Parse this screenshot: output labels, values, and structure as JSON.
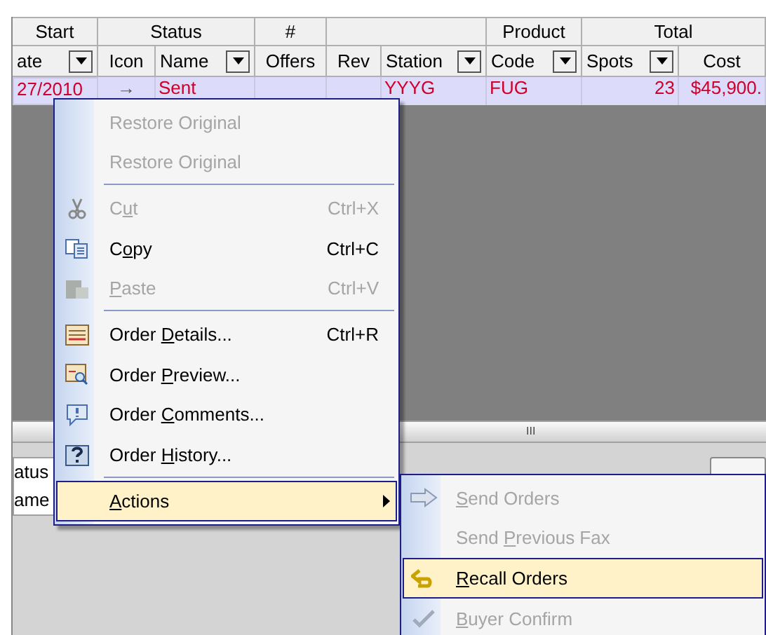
{
  "grid": {
    "groups": [
      {
        "kind": "labeled",
        "label": "Start"
      },
      {
        "kind": "labeled",
        "label": "Status"
      },
      {
        "kind": "labeled",
        "label": "#"
      },
      {
        "kind": "blank"
      },
      {
        "kind": "labeled",
        "label": "Product"
      },
      {
        "kind": "labeled",
        "label": "Total"
      }
    ],
    "columns": [
      {
        "label": "ate",
        "filter": true
      },
      {
        "label": "Icon",
        "filter": false
      },
      {
        "label": "Name",
        "filter": true
      },
      {
        "label": "Offers",
        "filter": false
      },
      {
        "label": "Rev",
        "filter": false
      },
      {
        "label": "Station",
        "filter": true
      },
      {
        "label": "Code",
        "filter": true
      },
      {
        "label": "Spots",
        "filter": true
      },
      {
        "label": "Cost",
        "filter": false
      }
    ],
    "rows": [
      {
        "selected": true,
        "cells": [
          "27/2010",
          "→",
          "Sent",
          "",
          "",
          "YYYG",
          "FUG",
          "23",
          "$45,900."
        ]
      }
    ]
  },
  "lower_pane": {
    "header": [
      "atus",
      "ame"
    ],
    "splitter_grip": "III"
  },
  "context_menu": {
    "items": [
      {
        "kind": "item",
        "label": {
          "pre": "Restore Original"
        },
        "disabled": true,
        "selected": false
      },
      {
        "kind": "item",
        "label": {
          "pre": "Restore Original"
        },
        "disabled": true,
        "selected": false
      },
      {
        "kind": "separator"
      },
      {
        "kind": "item",
        "label": {
          "pre": "C",
          "key": "u",
          "post": "t"
        },
        "shortcut": "Ctrl+X",
        "disabled": true,
        "selected": false
      },
      {
        "kind": "item",
        "label": {
          "pre": "C",
          "key": "o",
          "post": "py"
        },
        "shortcut": "Ctrl+C",
        "disabled": false,
        "selected": false
      },
      {
        "kind": "item",
        "label": {
          "key": "P",
          "post": "aste"
        },
        "shortcut": "Ctrl+V",
        "disabled": true,
        "selected": false
      },
      {
        "kind": "separator"
      },
      {
        "kind": "item",
        "label": {
          "pre": "Order ",
          "key": "D",
          "post": "etails..."
        },
        "shortcut": "Ctrl+R",
        "disabled": false,
        "selected": false
      },
      {
        "kind": "item",
        "label": {
          "pre": "Order ",
          "key": "P",
          "post": "review..."
        },
        "disabled": false,
        "selected": false
      },
      {
        "kind": "item",
        "label": {
          "pre": "Order ",
          "key": "C",
          "post": "omments..."
        },
        "disabled": false,
        "selected": false
      },
      {
        "kind": "item",
        "label": {
          "pre": "Order ",
          "key": "H",
          "post": "istory..."
        },
        "disabled": false,
        "selected": false
      },
      {
        "kind": "separator"
      },
      {
        "kind": "submenu",
        "label": {
          "key": "A",
          "post": "ctions"
        },
        "disabled": false,
        "selected": true
      }
    ]
  },
  "submenu": {
    "items": [
      {
        "label": {
          "key": "S",
          "post": "end Orders"
        },
        "disabled": true,
        "selected": false
      },
      {
        "label": {
          "pre": "Send ",
          "key": "P",
          "post": "revious Fax"
        },
        "disabled": true,
        "selected": false
      },
      {
        "label": {
          "key": "R",
          "post": "ecall Orders"
        },
        "disabled": false,
        "selected": true
      },
      {
        "label": {
          "key": "B",
          "post": "uyer Confirm"
        },
        "disabled": true,
        "selected": false
      }
    ]
  }
}
